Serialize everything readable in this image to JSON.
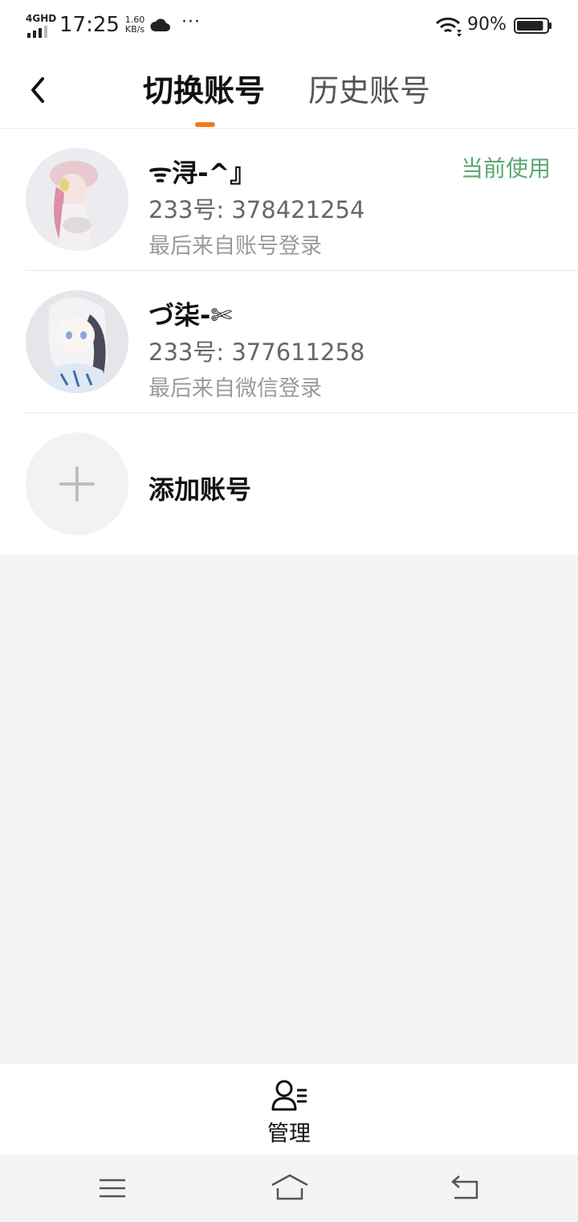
{
  "status_bar": {
    "network": "4GHD",
    "time": "17:25",
    "speed_value": "1.60",
    "speed_unit": "KB/s",
    "more": "···",
    "battery_percent": "90%",
    "battery_level": 0.9
  },
  "header": {
    "tabs": [
      {
        "label": "切换账号",
        "active": true
      },
      {
        "label": "历史账号",
        "active": false
      }
    ],
    "accent_color": "#f07a25"
  },
  "accounts": [
    {
      "name": "ᯤ浔-^』",
      "id": "233号: 378421254",
      "login": "最后来自账号登录",
      "status": "当前使用"
    },
    {
      "name": "づ柒-✄",
      "id": "233号: 377611258",
      "login": "最后来自微信登录"
    }
  ],
  "add_account": {
    "label": "添加账号"
  },
  "manage": {
    "label": "管理"
  },
  "colors": {
    "current_status": "#5aa86e",
    "background": "#f4f4f4"
  }
}
